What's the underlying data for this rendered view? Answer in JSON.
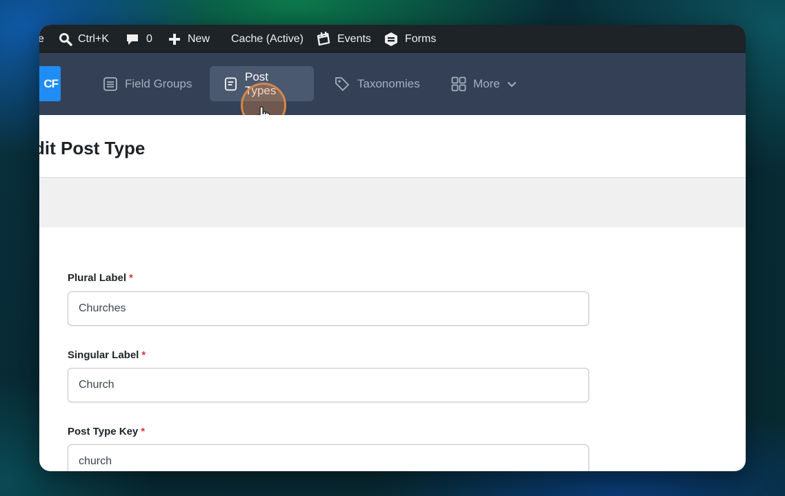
{
  "adminbar": {
    "cut_label": "e",
    "search_shortcut": "Ctrl+K",
    "comments_count": "0",
    "new_label": "New",
    "cache_label": "Cache (Active)",
    "events_label": "Events",
    "forms_label": "Forms"
  },
  "acf_nav": {
    "logo_text": "CF",
    "tabs": [
      {
        "label": "Field Groups"
      },
      {
        "label": "Post Types"
      },
      {
        "label": "Taxonomies"
      },
      {
        "label": "More"
      }
    ]
  },
  "page": {
    "title": "dit Post Type"
  },
  "form": {
    "plural_label": {
      "label": "Plural Label",
      "required": "*",
      "value": "Churches"
    },
    "singular_label": {
      "label": "Singular Label",
      "required": "*",
      "value": "Church"
    },
    "post_type_key": {
      "label": "Post Type Key",
      "required": "*",
      "value": "church"
    }
  },
  "colors": {
    "admin_bar": "#1d2327",
    "acf_nav": "#344055",
    "acf_logo": "#1f8df5",
    "required": "#d63638",
    "cursor_highlight": "#d9874a"
  }
}
